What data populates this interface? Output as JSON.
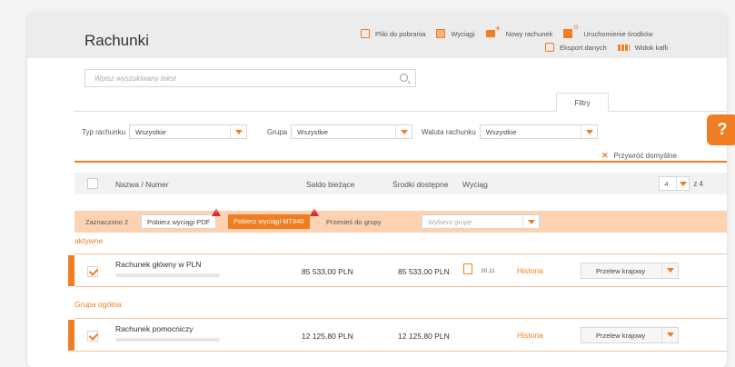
{
  "page": {
    "title": "Rachunki"
  },
  "header_actions": {
    "row1": [
      {
        "label": "Pliki do pobrania",
        "icon": "file-icon"
      },
      {
        "label": "Wyciągi",
        "icon": "statements-icon"
      },
      {
        "label": "Nowy rachunek",
        "icon": "new-account-icon"
      },
      {
        "label": "Uruchomienie środków",
        "icon": "funds-icon"
      }
    ],
    "row2": [
      {
        "label": "Eksport danych",
        "icon": "export-icon"
      },
      {
        "label": "Widok kafli",
        "icon": "tiles-icon"
      }
    ]
  },
  "search": {
    "placeholder": "Wpisz wyszukiwany tekst"
  },
  "filters": {
    "tab_label": "Filtry",
    "account_type": {
      "label": "Typ rachunku",
      "value": "Wszystkie"
    },
    "group": {
      "label": "Grupa",
      "value": "Wszystkie"
    },
    "currency": {
      "label": "Waluta rachunku",
      "value": "Wszystkie"
    },
    "reset_label": "Przywróć domyślne"
  },
  "table": {
    "headers": {
      "name": "Nazwa / Numer",
      "balance": "Saldo bieżące",
      "available": "Środki dostępne",
      "statement": "Wyciąg"
    },
    "pager": {
      "current": "4",
      "of_label": "z 4"
    }
  },
  "selection": {
    "count_label": "Zaznaczono 2",
    "pdf_button": "Pobierz wyciągi PDF",
    "mt940_button": "Pobierz wyciągi MT940",
    "move_label": "Przenieś do grupy",
    "group_placeholder": "Wybierz grupę"
  },
  "sections": [
    {
      "title": "aktywne",
      "rows": [
        {
          "name": "Rachunek główny w PLN",
          "balance": "85 533,00 PLN",
          "available": "85 533,00 PLN",
          "statement_date": "30.11",
          "history": "Historia",
          "action": "Przelew krajowy"
        }
      ]
    },
    {
      "title": "Grupa ogólna",
      "rows": [
        {
          "name": "Rachunek pomocniczy",
          "balance": "12 125,80 PLN",
          "available": "12 125,80 PLN",
          "history": "Historia",
          "action": "Przelew krajowy"
        }
      ]
    }
  ],
  "help": {
    "label": "?"
  },
  "colors": {
    "accent": "#f07d22",
    "header_bg": "#ececec",
    "selection_bg": "#fbd3b2"
  }
}
